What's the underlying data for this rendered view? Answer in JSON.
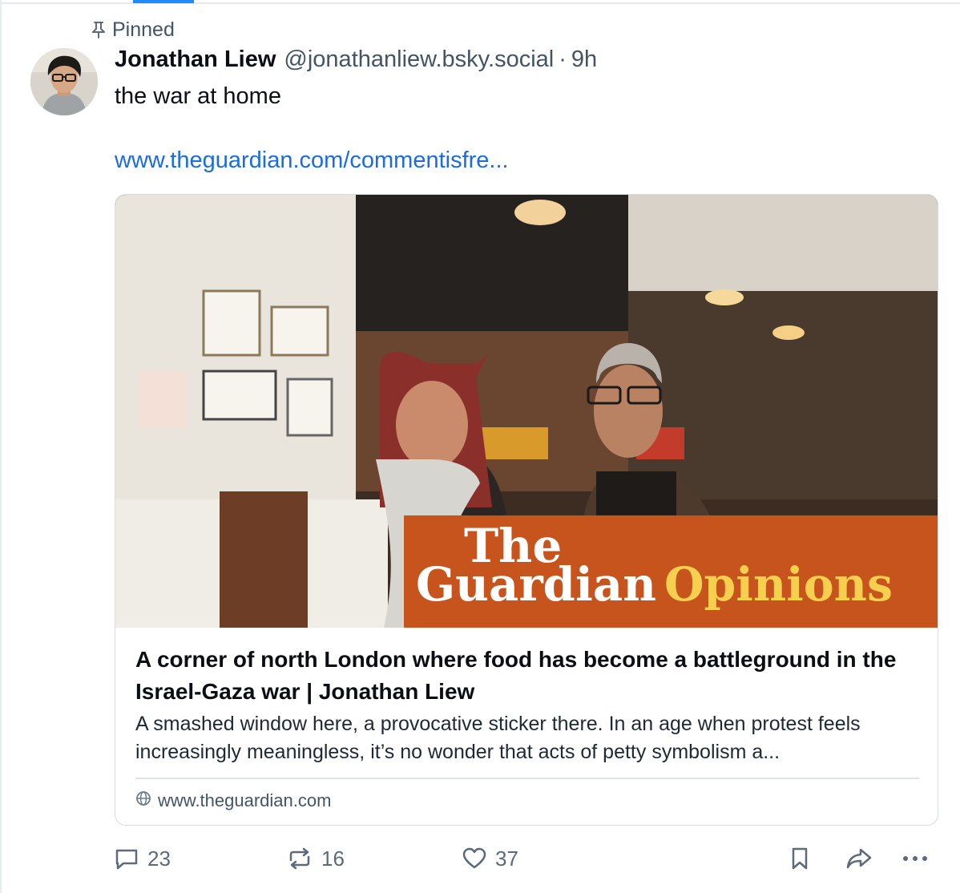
{
  "pinned_label": "Pinned",
  "post": {
    "author_name": "Jonathan Liew",
    "author_handle": "@jonathanliew.bsky.social",
    "separator": "·",
    "time": "9h",
    "text": "the war at home",
    "link_text": "www.theguardian.com/commentisfre..."
  },
  "card": {
    "title": "A corner of north London where food has become a battleground in the Israel-Gaza war | Jonathan Liew",
    "description": "A smashed window here, a provocative sticker there. In an age when protest feels increasingly meaningless, it’s no wonder that acts of petty symbolism a...",
    "domain": "www.theguardian.com",
    "banner_line1": "The",
    "banner_line2": "Guardian",
    "banner_section": "Opinions",
    "banner_color": "#c8541d"
  },
  "actions": {
    "replies": "23",
    "reposts": "16",
    "likes": "37"
  },
  "colors": {
    "link": "#1a6ce1",
    "muted": "#425466",
    "accent": "#1d8cf8"
  }
}
